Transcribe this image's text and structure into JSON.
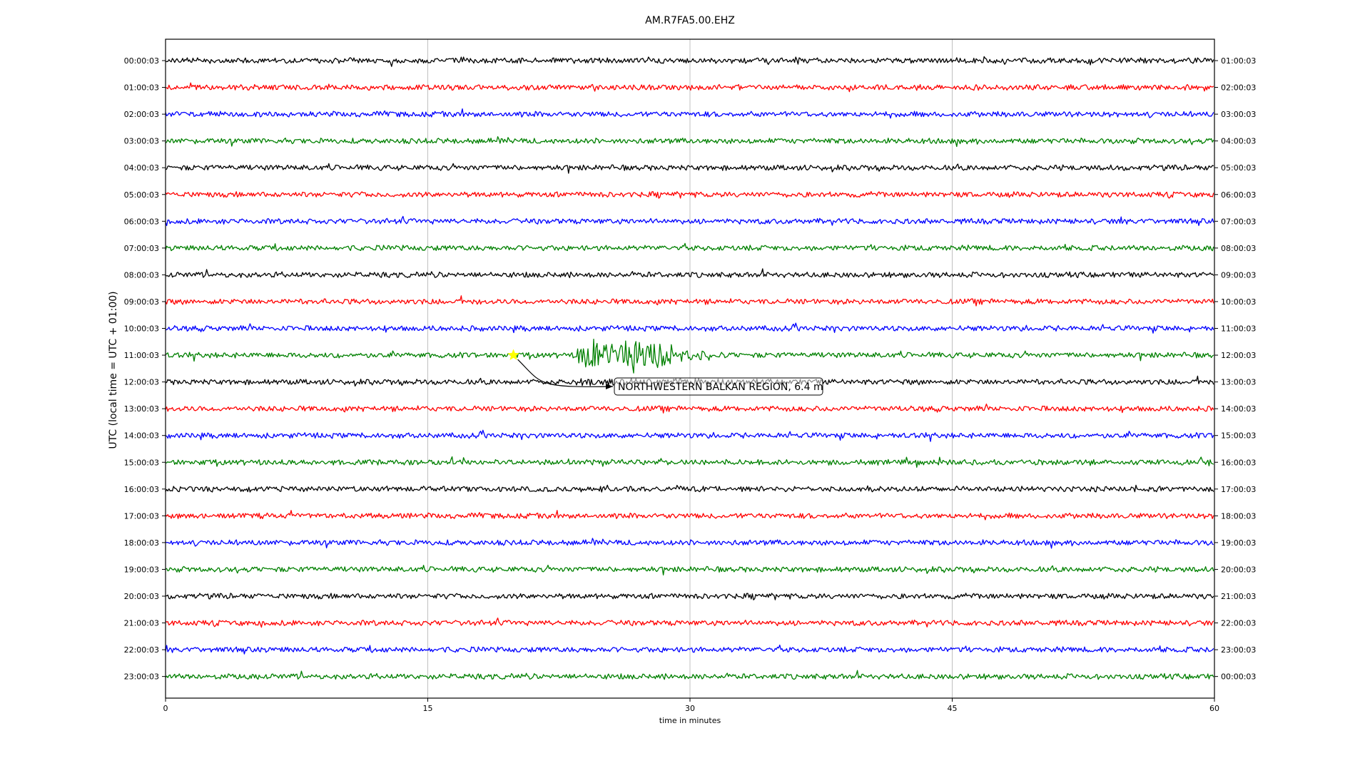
{
  "chart_data": {
    "type": "line",
    "title": "AM.R7FA5.00.EHZ",
    "xlabel": "time in minutes",
    "ylabel": "UTC (local time = UTC + 01:00)",
    "xlim": [
      0,
      60
    ],
    "x_ticks": [
      "0",
      "15",
      "30",
      "45",
      "60"
    ],
    "grid": "vertical lines at 15-minute intervals",
    "trace_colors": [
      "#000000",
      "#ff0000",
      "#0000ff",
      "#008000"
    ],
    "left_ticks": [
      "00:00:03",
      "01:00:03",
      "02:00:03",
      "03:00:03",
      "04:00:03",
      "05:00:03",
      "06:00:03",
      "07:00:03",
      "08:00:03",
      "09:00:03",
      "10:00:03",
      "11:00:03",
      "12:00:03",
      "13:00:03",
      "14:00:03",
      "15:00:03",
      "16:00:03",
      "17:00:03",
      "18:00:03",
      "19:00:03",
      "20:00:03",
      "21:00:03",
      "22:00:03",
      "23:00:03"
    ],
    "right_ticks": [
      "01:00:03",
      "02:00:03",
      "03:00:03",
      "04:00:03",
      "05:00:03",
      "06:00:03",
      "07:00:03",
      "08:00:03",
      "09:00:03",
      "10:00:03",
      "11:00:03",
      "12:00:03",
      "13:00:03",
      "14:00:03",
      "15:00:03",
      "16:00:03",
      "17:00:03",
      "18:00:03",
      "19:00:03",
      "20:00:03",
      "21:00:03",
      "22:00:03",
      "23:00:03",
      "00:00:03"
    ],
    "event": {
      "label": "NORTHWESTERN BALKAN REGION, 6.4 m",
      "row": 11,
      "origin_minute": 19.9,
      "arrival_minute": 23.5,
      "coda_end_minute": 32,
      "marker_color": "#ffff00"
    }
  }
}
